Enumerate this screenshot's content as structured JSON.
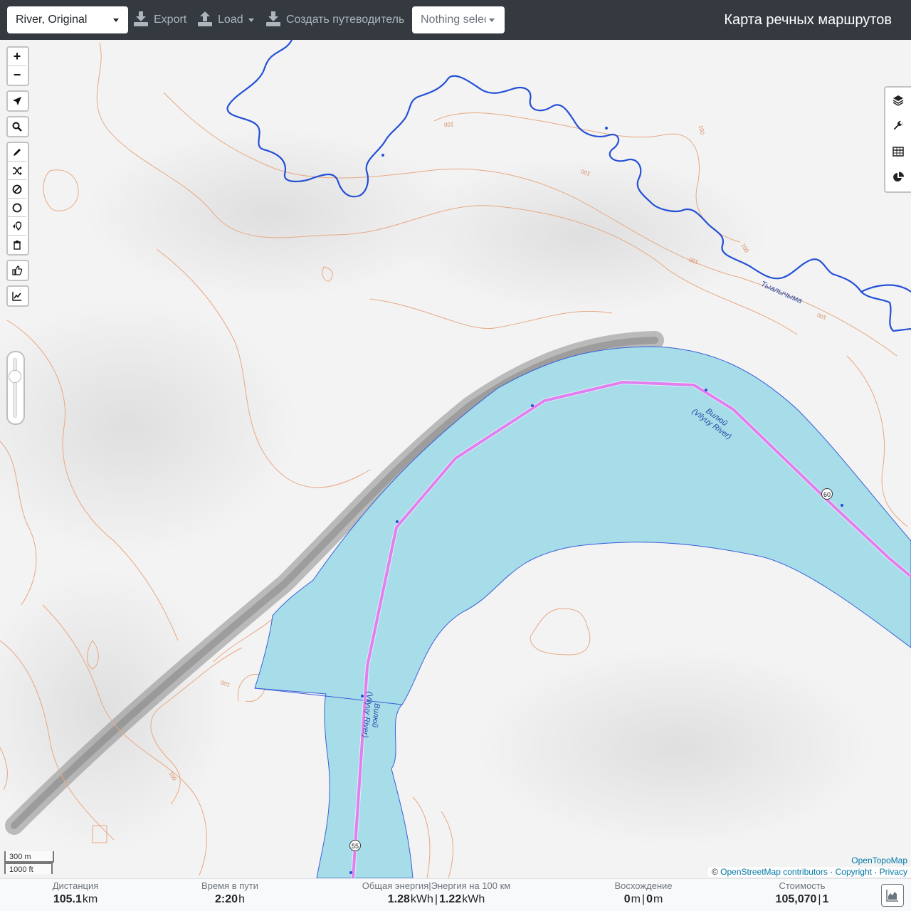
{
  "toolbar": {
    "profile_value": "River, Original",
    "export_label": "Export",
    "load_label": "Load",
    "guide_label": "Создать путеводитель",
    "selection_placeholder": "Nothing selected",
    "app_title": "Карта речных маршрутов"
  },
  "map_controls": {
    "zoom_in": "+",
    "zoom_out": "−",
    "opacity_level_fraction": 0.3
  },
  "map_labels": {
    "river_main_1_name": "Вилюй",
    "river_main_1_alt": "(Vilyuy River)",
    "river_main_2_name": "Вилюй",
    "river_main_2_alt": "(Vilyuy River)",
    "tributary_name": "Тыалычыма",
    "km_marker_60": "60",
    "km_marker_55": "55",
    "contour_labels": [
      "100",
      "100",
      "100",
      "100",
      "100",
      "100",
      "100",
      "100"
    ]
  },
  "scale": {
    "metric": "300 m",
    "imperial": "1000 ft"
  },
  "attribution": {
    "provider": "OpenTopoMap",
    "prefix": "©",
    "osm": "OpenStreetMap contributors",
    "sep": "·",
    "copyright": "Copyright",
    "privacy": "Privacy"
  },
  "stats": {
    "distance": {
      "label": "Дистанция",
      "value": "105.1",
      "unit": "km"
    },
    "time": {
      "label": "Время в пути",
      "value": "2:20",
      "unit": "h"
    },
    "energy": {
      "label": "Общая энергия",
      "label2": "Энергия на 100 км",
      "value": "1.28",
      "unit": "kWh",
      "value2": "1.22",
      "unit2": "kWh"
    },
    "ascent": {
      "label": "Восхождение",
      "value": "0",
      "unit": "m",
      "value2": "0",
      "unit2": "m"
    },
    "cost": {
      "label": "Стоимость",
      "value": "105,070",
      "value2": "1"
    },
    "separator": "|"
  },
  "colors": {
    "topbar": "#343a40",
    "water": "#a6dde8",
    "route": "#e27ff0",
    "stream": "#2450d6",
    "contour": "#e8a882"
  }
}
